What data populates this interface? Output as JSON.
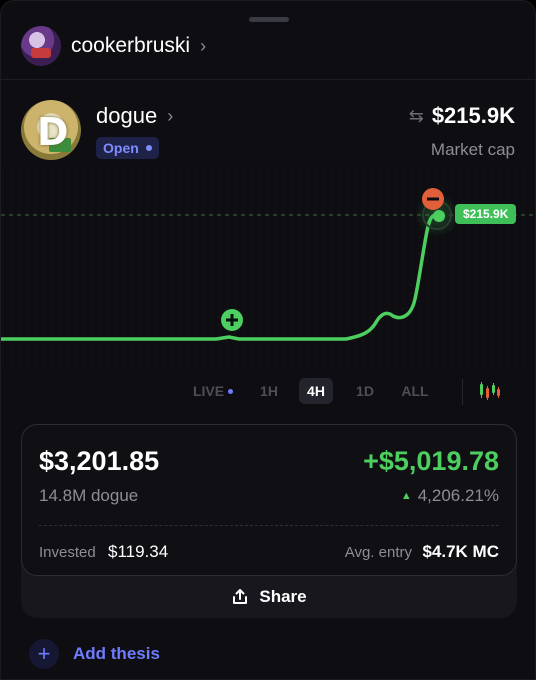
{
  "header": {
    "username": "cookerbruski",
    "chevron": "chevron-right-icon"
  },
  "token": {
    "name": "dogue",
    "status": "Open",
    "market_cap_value": "$215.9K",
    "market_cap_label": "Market cap",
    "avatar_letter": "D"
  },
  "chart": {
    "current_price_tag": "$215.9K",
    "colors": {
      "line": "#4ccf5e",
      "sell_marker": "#e1603a",
      "buy_marker": "#4ccf5e"
    }
  },
  "timeframes": {
    "live": "LIVE",
    "h1": "1H",
    "h4": "4H",
    "d1": "1D",
    "all": "ALL",
    "selected": "4H"
  },
  "position": {
    "value": "$3,201.85",
    "pnl": "+$5,019.78",
    "amount": "14.8M dogue",
    "pnl_percent": "4,206.21%",
    "invested_label": "Invested",
    "invested_value": "$119.34",
    "avg_entry_label": "Avg. entry",
    "avg_entry_value": "$4.7K MC",
    "share_label": "Share"
  },
  "thesis": {
    "add_label": "Add thesis"
  }
}
